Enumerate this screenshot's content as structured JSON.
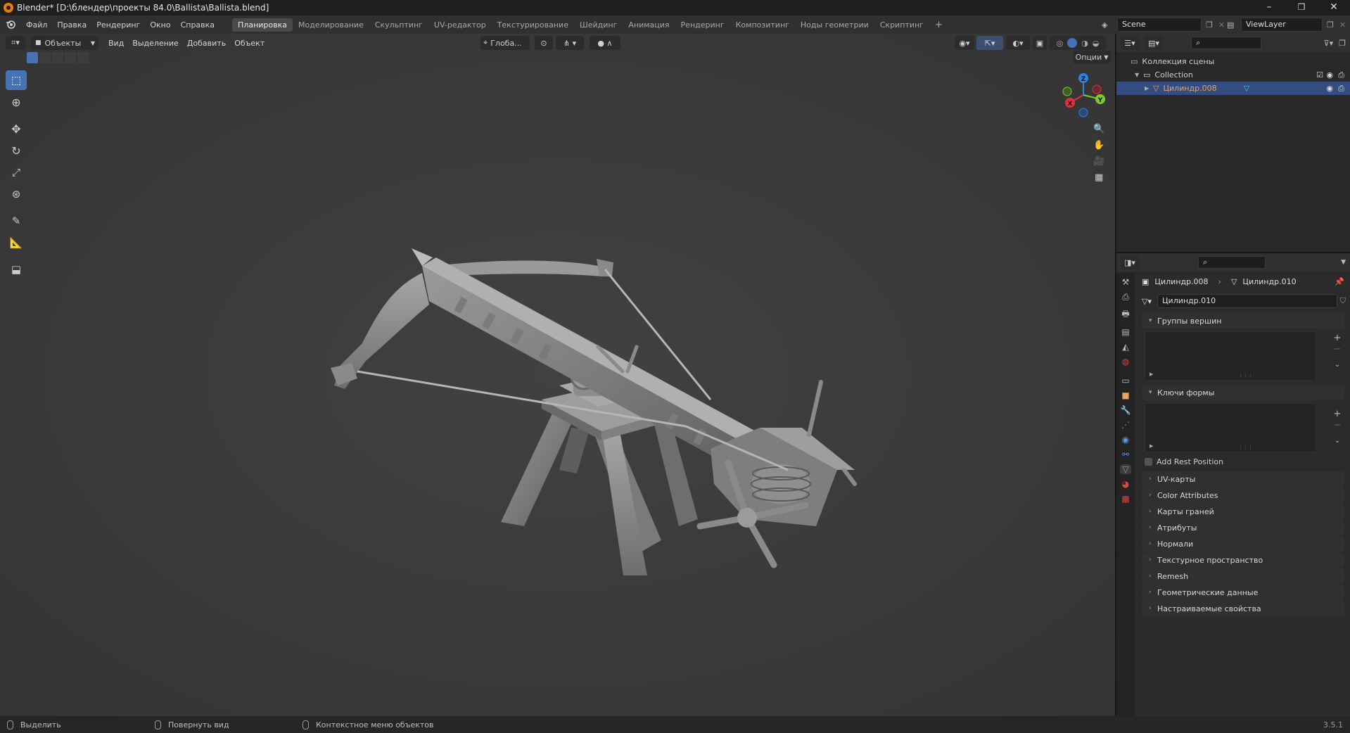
{
  "window": {
    "title": "Blender* [D:\\блендер\\проекты 84.0\\Ballista\\Ballista.blend]",
    "controls": [
      "–",
      "❐",
      "✕"
    ]
  },
  "menubar": {
    "menus": [
      "Файл",
      "Правка",
      "Рендеринг",
      "Окно",
      "Справка"
    ],
    "workspaces": [
      "Планировка",
      "Моделирование",
      "Скульптинг",
      "UV-редактор",
      "Текстурирование",
      "Шейдинг",
      "Анимация",
      "Рендеринг",
      "Композитинг",
      "Ноды геометрии",
      "Скриптинг"
    ],
    "active_workspace": "Планировка",
    "add_tab": "+",
    "scene": "Scene",
    "view_layer": "ViewLayer"
  },
  "viewport_header": {
    "mode": "Объекты",
    "menus": [
      "Вид",
      "Выделение",
      "Добавить",
      "Объект"
    ],
    "transform_orientation": "Глоба...",
    "options": "Опции"
  },
  "toolbar": {
    "tools": [
      "select-box-tool",
      "cursor-tool",
      "move-tool",
      "rotate-tool",
      "scale-tool",
      "transform-tool",
      "annotate-tool",
      "measure-tool",
      "add-cube-tool"
    ],
    "active": "select-box-tool"
  },
  "gizmo": {
    "axes": [
      "X",
      "Y",
      "Z"
    ],
    "colors": {
      "x": "#e0323c",
      "y": "#7ec82f",
      "z": "#2d83e0"
    }
  },
  "outliner": {
    "root": "Коллекция сцены",
    "collection": "Collection",
    "object": "Цилиндр.008"
  },
  "properties": {
    "breadcrumb_object": "Цилиндр.008",
    "breadcrumb_data": "Цилиндр.010",
    "mesh_name": "Цилиндр.010",
    "panels_open": [
      {
        "label": "Группы вершин"
      },
      {
        "label": "Ключи формы"
      }
    ],
    "add_rest_position": "Add Rest Position",
    "panels_closed": [
      "UV-карты",
      "Color Attributes",
      "Карты граней",
      "Атрибуты",
      "Нормали",
      "Текстурное пространство",
      "Remesh",
      "Геометрические данные",
      "Настраиваемые свойства"
    ]
  },
  "statusbar": {
    "left": "Выделить",
    "middle": "Повернуть вид",
    "right": "Контекстное меню объектов",
    "version": "3.5.1"
  },
  "colors": {
    "accent": "#4772b3",
    "highlight_row": "#334d80",
    "object_orange": "#e8a25c"
  }
}
